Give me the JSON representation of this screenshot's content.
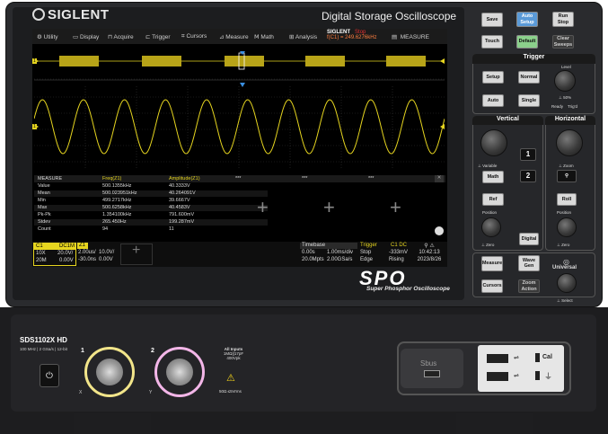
{
  "header": {
    "brand": "SIGLENT",
    "title": "Digital Storage Oscilloscope"
  },
  "menubar": {
    "items": [
      "Utility",
      "Display",
      "Acquire",
      "Trigger",
      "Cursors",
      "Measure",
      "Math",
      "Analysis"
    ],
    "trigger_status_label": "SIGLENT",
    "trigger_status": "Stop",
    "trigger_freq": "f(C1) = 249.6276kHz",
    "measure_label": "MEASURE"
  },
  "colors": {
    "ch1": "#e6d51f",
    "accent_blue": "#3a8fe0",
    "stop_red": "#e03030",
    "bg": "#000000"
  },
  "measure": {
    "title": "MEASURE",
    "col1_header": "Freq(Z1)",
    "col2_header": "Amplitude(Z1)",
    "extra_headers": [
      "***",
      "***",
      "***"
    ],
    "rows": [
      {
        "label": "Value",
        "v1": "500.1355kHz",
        "v2": "40.3333V"
      },
      {
        "label": "Mean",
        "v1": "500.023951kHz",
        "v2": "40.264091V"
      },
      {
        "label": "Min",
        "v1": "499.2717kHz",
        "v2": "39.6667V"
      },
      {
        "label": "Max",
        "v1": "500.6258kHz",
        "v2": "40.4583V"
      },
      {
        "label": "Pk-Pk",
        "v1": "1.354100kHz",
        "v2": "791.600mV"
      },
      {
        "label": "Stdev",
        "v1": "265.450Hz",
        "v2": "199.287mV"
      },
      {
        "label": "Count",
        "v1": "94",
        "v2": "11"
      }
    ]
  },
  "status": {
    "c1_label": "C1",
    "c1_coupling": "DC1M",
    "z1_label": "Z1",
    "c1_probe": "10X",
    "c1_scale": "20.0V/",
    "c1_bw": "20M",
    "c1_offset": "0.00V",
    "z1_time": "2.00us/",
    "z1_pos": "-30.0ns",
    "z1_scale": "10.0V/",
    "z1_offset": "0.00V",
    "timebase_label": "Timebase",
    "timebase_delay": "0.00s",
    "timebase_scale": "1.00ms/div",
    "timebase_pts": "20.0Mpts",
    "timebase_rate": "2.00GSa/s",
    "trigger_label": "Trigger",
    "trigger_src": "C1 DC",
    "trigger_mode": "Stop",
    "trigger_level": "-333mV",
    "trigger_type": "Edge",
    "trigger_slope": "Rising",
    "time": "10:42:13",
    "date": "2023/8/26"
  },
  "logo": {
    "spo": "SPO",
    "spo_sub": "Super Phosphor Oscilloscope"
  },
  "panel": {
    "save": "Save",
    "auto_setup": "Auto Setup",
    "run_stop": "Run Stop",
    "touch": "Touch",
    "default": "Default",
    "clear_sweeps": "Clear Sweeps",
    "trigger_title": "Trigger",
    "setup": "Setup",
    "normal": "Normal",
    "level": "Level",
    "auto": "Auto",
    "single": "Single",
    "fifty": "50%",
    "ready": "Ready",
    "trigd": "Trig'd",
    "vertical_title": "Vertical",
    "horizontal_title": "Horizontal",
    "ch1": "1",
    "ch2": "2",
    "math": "Math",
    "ref": "Ref",
    "roll": "Roll",
    "digital": "Digital",
    "variable": "Variable",
    "zoom": "Zoom",
    "position": "Position",
    "zero": "Zero",
    "measure": "Measure",
    "wave_gen": "Wave Gen",
    "cursors": "Cursors",
    "zoom_action": "Zoom Action",
    "universal": "Universal",
    "select": "Select"
  },
  "front": {
    "model": "SDS1102X HD",
    "model_sub": "100 MHz | 2 GSa/s | 12-bit",
    "ch1_label": "1",
    "ch2_label": "2",
    "x_label": "X",
    "y_label": "Y",
    "all_inputs": "All Inputs",
    "input_spec": "1MΩ||17pF 400Vpk",
    "cat": "50Ω ≤5Vrms",
    "sbus": "Sbus",
    "cal": "Cal"
  }
}
